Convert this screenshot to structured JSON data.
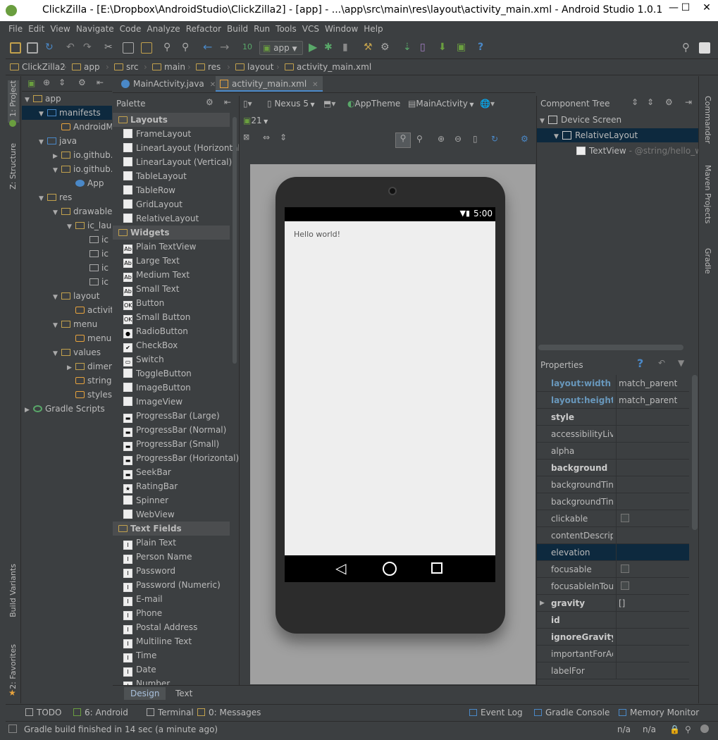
{
  "window": {
    "title": "ClickZilla - [E:\\Dropbox\\AndroidStudio\\ClickZilla2] - [app] - ...\\app\\src\\main\\res\\layout\\activity_main.xml - Android Studio 1.0.1"
  },
  "menu": [
    "File",
    "Edit",
    "View",
    "Navigate",
    "Code",
    "Analyze",
    "Refactor",
    "Build",
    "Run",
    "Tools",
    "VCS",
    "Window",
    "Help"
  ],
  "toolbar": {
    "run_config": "app"
  },
  "breadcrumb": [
    "ClickZilla2",
    "app",
    "src",
    "main",
    "res",
    "layout",
    "activity_main.xml"
  ],
  "left_strip": {
    "project": "1: Project",
    "structure": "Z: Structure",
    "build_variants": "Build Variants",
    "favorites": "2: Favorites"
  },
  "right_strip": {
    "commander": "Commander",
    "maven": "Maven Projects",
    "gradle": "Gradle"
  },
  "project_tree": [
    {
      "label": "app",
      "indent": 0,
      "arrow": "▼",
      "type": "module"
    },
    {
      "label": "manifests",
      "indent": 1,
      "arrow": "▼",
      "type": "folder",
      "selected": true
    },
    {
      "label": "AndroidManifest.xml",
      "indent": 2,
      "arrow": "",
      "type": "xml"
    },
    {
      "label": "java",
      "indent": 1,
      "arrow": "▼",
      "type": "folder"
    },
    {
      "label": "io.github.",
      "indent": 2,
      "arrow": "▶",
      "type": "folder"
    },
    {
      "label": "io.github.",
      "indent": 2,
      "arrow": "▼",
      "type": "folder"
    },
    {
      "label": "App",
      "indent": 3,
      "arrow": "",
      "type": "class"
    },
    {
      "label": "res",
      "indent": 1,
      "arrow": "▼",
      "type": "folder"
    },
    {
      "label": "drawable",
      "indent": 2,
      "arrow": "▼",
      "type": "folder"
    },
    {
      "label": "ic_launcher",
      "indent": 3,
      "arrow": "▼",
      "type": "folder"
    },
    {
      "label": "ic",
      "indent": 4,
      "arrow": "",
      "type": "file"
    },
    {
      "label": "ic",
      "indent": 4,
      "arrow": "",
      "type": "file"
    },
    {
      "label": "ic",
      "indent": 4,
      "arrow": "",
      "type": "file"
    },
    {
      "label": "ic",
      "indent": 4,
      "arrow": "",
      "type": "file"
    },
    {
      "label": "layout",
      "indent": 2,
      "arrow": "▼",
      "type": "folder"
    },
    {
      "label": "activity",
      "indent": 3,
      "arrow": "",
      "type": "xml"
    },
    {
      "label": "menu",
      "indent": 2,
      "arrow": "▼",
      "type": "folder"
    },
    {
      "label": "menu",
      "indent": 3,
      "arrow": "",
      "type": "xml"
    },
    {
      "label": "values",
      "indent": 2,
      "arrow": "▼",
      "type": "folder"
    },
    {
      "label": "dimens",
      "indent": 3,
      "arrow": "▶",
      "type": "folder"
    },
    {
      "label": "strings",
      "indent": 3,
      "arrow": "",
      "type": "xml"
    },
    {
      "label": "styles",
      "indent": 3,
      "arrow": "",
      "type": "xml"
    },
    {
      "label": "Gradle Scripts",
      "indent": 0,
      "arrow": "▶",
      "type": "gradle"
    }
  ],
  "tabs": [
    {
      "label": "MainActivity.java",
      "active": false
    },
    {
      "label": "activity_main.xml",
      "active": true
    }
  ],
  "palette": {
    "title": "Palette",
    "items": [
      {
        "label": "Layouts",
        "cat": true
      },
      {
        "label": "FrameLayout",
        "icon": ""
      },
      {
        "label": "LinearLayout (Horizontal)",
        "icon": ""
      },
      {
        "label": "LinearLayout (Vertical)",
        "icon": ""
      },
      {
        "label": "TableLayout",
        "icon": ""
      },
      {
        "label": "TableRow",
        "icon": ""
      },
      {
        "label": "GridLayout",
        "icon": ""
      },
      {
        "label": "RelativeLayout",
        "icon": ""
      },
      {
        "label": "Widgets",
        "cat": true
      },
      {
        "label": "Plain TextView",
        "icon": "Ab"
      },
      {
        "label": "Large Text",
        "icon": "Ab"
      },
      {
        "label": "Medium Text",
        "icon": "Ab"
      },
      {
        "label": "Small Text",
        "icon": "Ab"
      },
      {
        "label": "Button",
        "icon": "OK"
      },
      {
        "label": "Small Button",
        "icon": "OK"
      },
      {
        "label": "RadioButton",
        "icon": "●"
      },
      {
        "label": "CheckBox",
        "icon": "✔"
      },
      {
        "label": "Switch",
        "icon": "▭"
      },
      {
        "label": "ToggleButton",
        "icon": ""
      },
      {
        "label": "ImageButton",
        "icon": ""
      },
      {
        "label": "ImageView",
        "icon": ""
      },
      {
        "label": "ProgressBar (Large)",
        "icon": "▬"
      },
      {
        "label": "ProgressBar (Normal)",
        "icon": "▬"
      },
      {
        "label": "ProgressBar (Small)",
        "icon": "▬"
      },
      {
        "label": "ProgressBar (Horizontal)",
        "icon": "▬"
      },
      {
        "label": "SeekBar",
        "icon": "▬"
      },
      {
        "label": "RatingBar",
        "icon": "★"
      },
      {
        "label": "Spinner",
        "icon": ""
      },
      {
        "label": "WebView",
        "icon": ""
      },
      {
        "label": "Text Fields",
        "cat": true
      },
      {
        "label": "Plain Text",
        "icon": "I"
      },
      {
        "label": "Person Name",
        "icon": "I"
      },
      {
        "label": "Password",
        "icon": "I"
      },
      {
        "label": "Password (Numeric)",
        "icon": "I"
      },
      {
        "label": "E-mail",
        "icon": "I"
      },
      {
        "label": "Phone",
        "icon": "I"
      },
      {
        "label": "Postal Address",
        "icon": "I"
      },
      {
        "label": "Multiline Text",
        "icon": "I"
      },
      {
        "label": "Time",
        "icon": "I"
      },
      {
        "label": "Date",
        "icon": "I"
      },
      {
        "label": "Number",
        "icon": "I"
      }
    ]
  },
  "design_toolbar": {
    "device": "Nexus 5",
    "theme": "AppTheme",
    "activity": "MainActivity",
    "api": "21"
  },
  "phone": {
    "time": "5:00",
    "hello": "Hello world!"
  },
  "component_tree": {
    "title": "Component Tree",
    "items": [
      {
        "label": "Device Screen",
        "indent": 0,
        "arrow": "▼"
      },
      {
        "label": "RelativeLayout",
        "indent": 1,
        "arrow": "▼",
        "selected": true
      },
      {
        "label": "TextView",
        "suffix": " - @string/hello_world",
        "indent": 2,
        "arrow": ""
      }
    ]
  },
  "properties": {
    "title": "Properties",
    "rows": [
      {
        "key": "layout:width",
        "value": "match_parent",
        "style": "blue"
      },
      {
        "key": "layout:height",
        "value": "match_parent",
        "style": "blue"
      },
      {
        "key": "style",
        "value": "",
        "style": "bold"
      },
      {
        "key": "accessibilityLiveRegion",
        "value": "",
        "style": ""
      },
      {
        "key": "alpha",
        "value": "",
        "style": ""
      },
      {
        "key": "background",
        "value": "",
        "style": "bold"
      },
      {
        "key": "backgroundTint",
        "value": "",
        "style": ""
      },
      {
        "key": "backgroundTintMode",
        "value": "",
        "style": ""
      },
      {
        "key": "clickable",
        "value": "",
        "style": "",
        "check": true
      },
      {
        "key": "contentDescription",
        "value": "",
        "style": ""
      },
      {
        "key": "elevation",
        "value": "",
        "style": "",
        "selected": true
      },
      {
        "key": "focusable",
        "value": "",
        "style": "",
        "check": true
      },
      {
        "key": "focusableInTouchMode",
        "value": "",
        "style": "",
        "check": true
      },
      {
        "key": "gravity",
        "value": "[]",
        "style": "bold",
        "arrow": "▶"
      },
      {
        "key": "id",
        "value": "",
        "style": "bold"
      },
      {
        "key": "ignoreGravity",
        "value": "",
        "style": "bold"
      },
      {
        "key": "importantForAccessibility",
        "value": "",
        "style": ""
      },
      {
        "key": "labelFor",
        "value": "",
        "style": ""
      }
    ]
  },
  "bottom_tabs": [
    {
      "label": "Design",
      "active": true
    },
    {
      "label": "Text",
      "active": false
    }
  ],
  "tool_windows": {
    "left": [
      {
        "label": "TODO",
        "u": ""
      },
      {
        "label": "6: Android",
        "u": "6"
      },
      {
        "label": "Terminal",
        "u": ""
      },
      {
        "label": "0: Messages",
        "u": "0"
      }
    ],
    "right": [
      {
        "label": "Event Log"
      },
      {
        "label": "Gradle Console"
      },
      {
        "label": "Memory Monitor"
      }
    ]
  },
  "status": {
    "message": "Gradle build finished in 14 sec (a minute ago)",
    "pos1": "n/a",
    "pos2": "n/a"
  },
  "colors": {
    "bg": "#3c3f41",
    "selection": "#0d293e",
    "accent": "#4a88c7",
    "run_green": "#59a869",
    "folder": "#c2a14d",
    "android_green": "#6a9e3f"
  }
}
